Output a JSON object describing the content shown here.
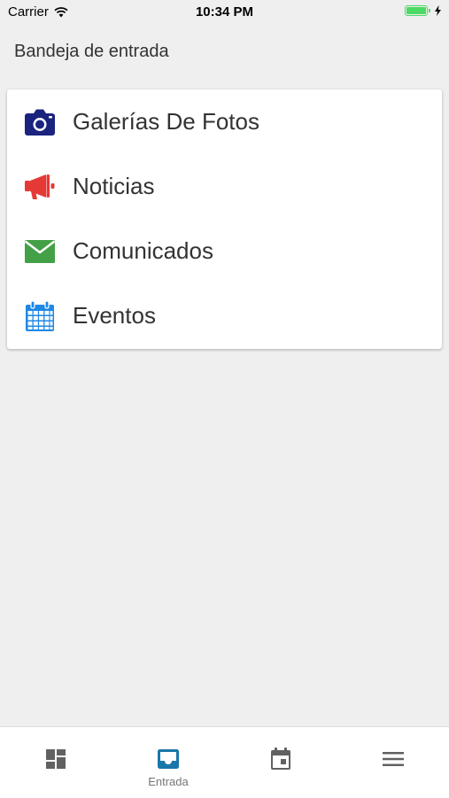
{
  "status_bar": {
    "carrier": "Carrier",
    "time": "10:34 PM"
  },
  "header": {
    "title": "Bandeja de entrada"
  },
  "menu": {
    "items": [
      {
        "label": "Galerías De Fotos",
        "icon": "camera-icon",
        "color": "#1a237e"
      },
      {
        "label": "Noticias",
        "icon": "megaphone-icon",
        "color": "#e53935"
      },
      {
        "label": "Comunicados",
        "icon": "envelope-icon",
        "color": "#43a047"
      },
      {
        "label": "Eventos",
        "icon": "calendar-icon",
        "color": "#1e88e5"
      }
    ]
  },
  "tab_bar": {
    "tabs": [
      {
        "icon": "dashboard-icon",
        "label": "",
        "active": false
      },
      {
        "icon": "inbox-icon",
        "label": "Entrada",
        "active": true
      },
      {
        "icon": "event-icon",
        "label": "",
        "active": false
      },
      {
        "icon": "menu-icon",
        "label": "",
        "active": false
      }
    ],
    "active_color": "#1976a8",
    "inactive_color": "#616161"
  }
}
